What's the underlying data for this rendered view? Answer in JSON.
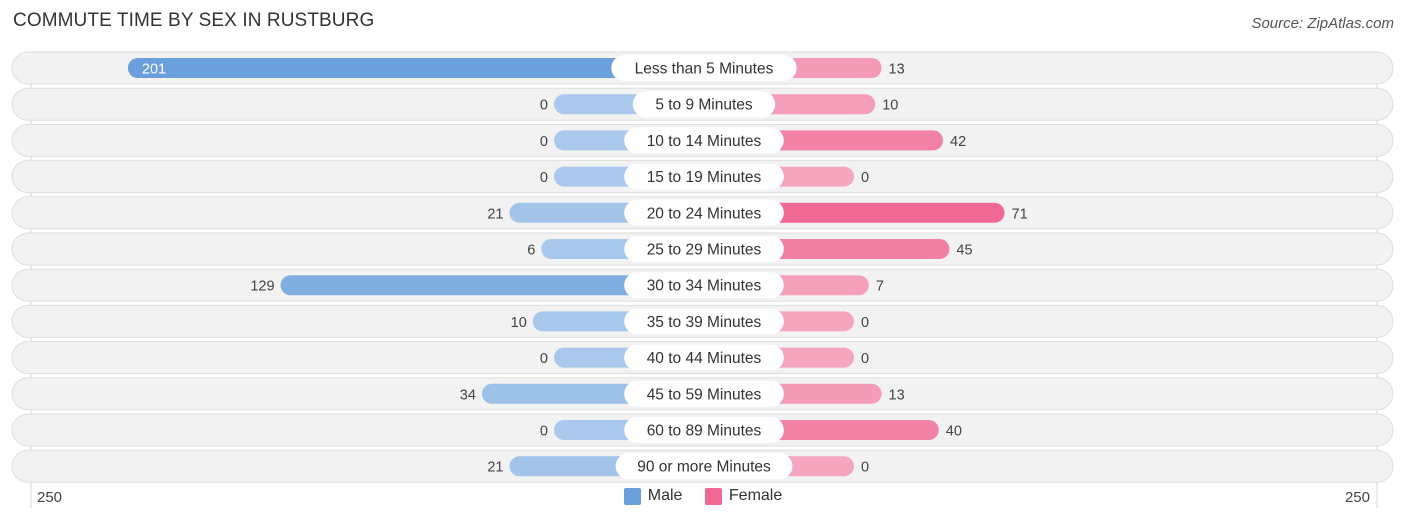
{
  "chart_data": {
    "type": "bar",
    "orientation": "horizontal-diverging",
    "title": "COMMUTE TIME BY SEX IN RUSTBURG",
    "source": "Source: ZipAtlas.com",
    "categories": [
      "Less than 5 Minutes",
      "5 to 9 Minutes",
      "10 to 14 Minutes",
      "15 to 19 Minutes",
      "20 to 24 Minutes",
      "25 to 29 Minutes",
      "30 to 34 Minutes",
      "35 to 39 Minutes",
      "40 to 44 Minutes",
      "45 to 59 Minutes",
      "60 to 89 Minutes",
      "90 or more Minutes"
    ],
    "series": [
      {
        "name": "Male",
        "color": "#6a9fdb",
        "values": [
          201,
          0,
          0,
          0,
          21,
          6,
          129,
          10,
          0,
          34,
          0,
          21
        ]
      },
      {
        "name": "Female",
        "color": "#f06894",
        "values": [
          13,
          10,
          42,
          0,
          71,
          45,
          7,
          0,
          0,
          13,
          40,
          0
        ]
      }
    ],
    "xlim": [
      250,
      250
    ],
    "axis_labels": {
      "left": "250",
      "right": "250"
    },
    "legend": {
      "position": "bottom-center",
      "items": [
        "Male",
        "Female"
      ]
    },
    "grid": false
  },
  "colors": {
    "male_strong": "#6a9fdb",
    "male_light": "#a9c8eb",
    "female_strong": "#f06894",
    "female_light": "#f5a6bf",
    "row_bg": "#f2f2f2"
  }
}
